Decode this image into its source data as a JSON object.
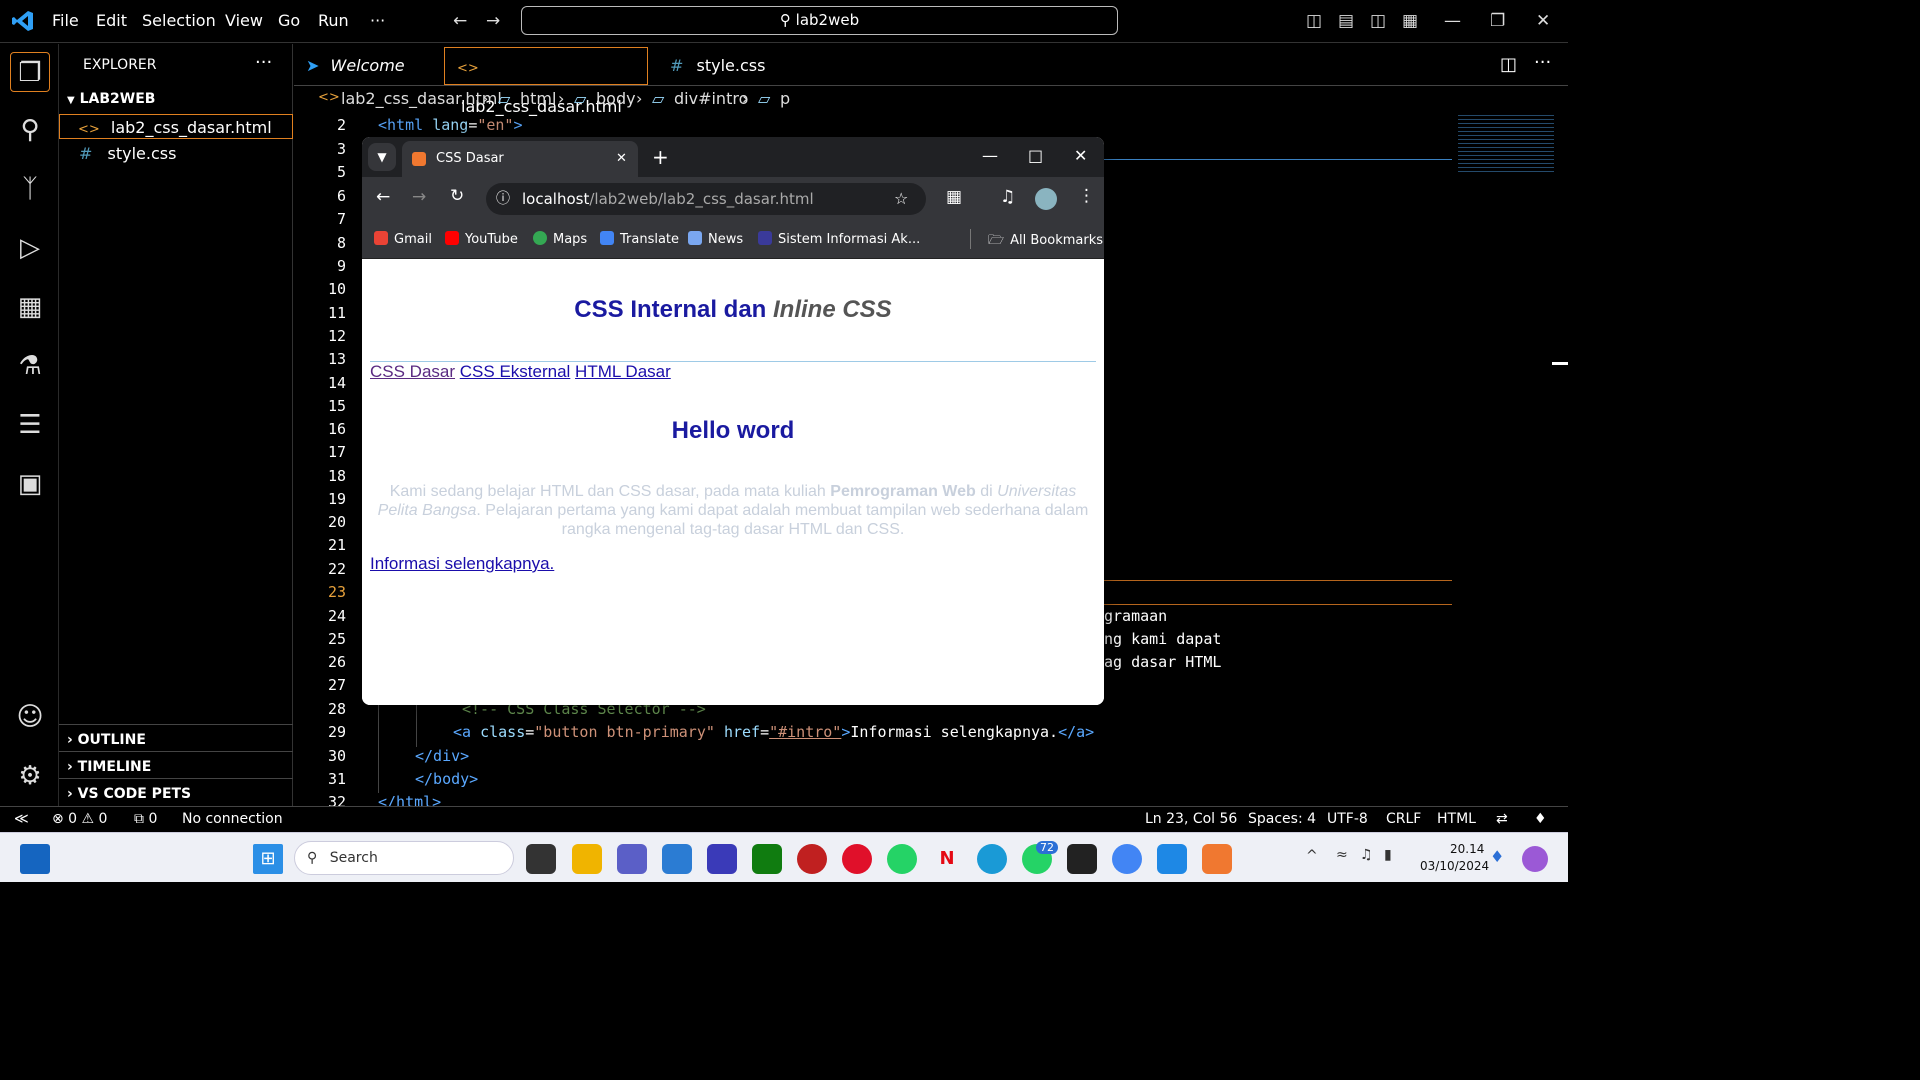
{
  "menu": [
    "File",
    "Edit",
    "Selection",
    "View",
    "Go",
    "Run",
    "···"
  ],
  "command_center": "lab2web",
  "explorer": {
    "title": "EXPLORER",
    "folder": "LAB2WEB",
    "files": [
      "lab2_css_dasar.html",
      "style.css"
    ],
    "sections": [
      "OUTLINE",
      "TIMELINE",
      "VS CODE PETS"
    ]
  },
  "tabs": [
    "Welcome",
    "lab2_css_dasar.html",
    "style.css"
  ],
  "breadcrumb": [
    "lab2_css_dasar.html",
    "html",
    "body",
    "div#intro",
    "p"
  ],
  "code": {
    "line2": {
      "num": "2",
      "tag_open": "<html ",
      "attr": "lang",
      "eq": "=",
      "val": "\"en\"",
      "tag_close": ">"
    },
    "line28": {
      "num": "28",
      "comment": "<!-- CSS Class Selector -->"
    },
    "line29": {
      "num": "29",
      "a_open": "<a ",
      "attr1": "class",
      "val1": "\"button btn-primary\"",
      "attr2": "href",
      "val2": "\"#intro\"",
      "text": "Informasi selengkapnya.",
      "a_close": "</a>"
    },
    "line30": {
      "num": "30",
      "text": "</div>"
    },
    "line31": {
      "num": "31",
      "text": "</body>"
    },
    "line32": {
      "num": "32",
      "text": "</html>"
    },
    "frag24": "gramaan",
    "frag25": "ng kami dapat",
    "frag26": "ag dasar HTML"
  },
  "line_numbers": [
    "3",
    "5",
    "6",
    "7",
    "8",
    "9",
    "10",
    "11",
    "12",
    "13",
    "14",
    "15",
    "16",
    "17",
    "18",
    "19",
    "20",
    "21",
    "22",
    "23",
    "24",
    "25",
    "26",
    "27"
  ],
  "status": {
    "errors": "⊗ 0 ⚠ 0",
    "ports": "⧉ 0",
    "connection": "No connection",
    "position": "Ln 23, Col 56",
    "spaces": "Spaces: 4",
    "encoding": "UTF-8",
    "eol": "CRLF",
    "language": "HTML"
  },
  "browser": {
    "tab_title": "CSS Dasar",
    "url_host": "localhost",
    "url_path": "/lab2web/lab2_css_dasar.html",
    "bookmarks": [
      "Gmail",
      "YouTube",
      "Maps",
      "Translate",
      "News",
      "Sistem Informasi Ak...",
      "All Bookmarks"
    ],
    "page": {
      "heading_a": "CSS Internal dan ",
      "heading_b": "Inline CSS",
      "nav": [
        "CSS Dasar",
        "CSS Eksternal",
        "HTML Dasar"
      ],
      "h2": "Hello word",
      "p1": "Kami sedang belajar HTML dan CSS dasar, pada mata kuliah ",
      "p_bold": "Pemrograman Web",
      "p2": " di ",
      "p_italic": "Universitas Pelita Bangsa",
      "p3": ". Pelajaran pertama yang kami dapat adalah membuat tampilan web sederhana dalam rangka mengenal tag-tag dasar HTML dan CSS.",
      "more_link": "Informasi selengkapnya."
    }
  },
  "taskbar": {
    "search": "Search",
    "time": "20.14",
    "date": "03/10/2024",
    "badge": "72"
  },
  "colors": {
    "accent": "#1e90ff",
    "heading": "#1a1aa0",
    "para": "#c8d0dc"
  }
}
